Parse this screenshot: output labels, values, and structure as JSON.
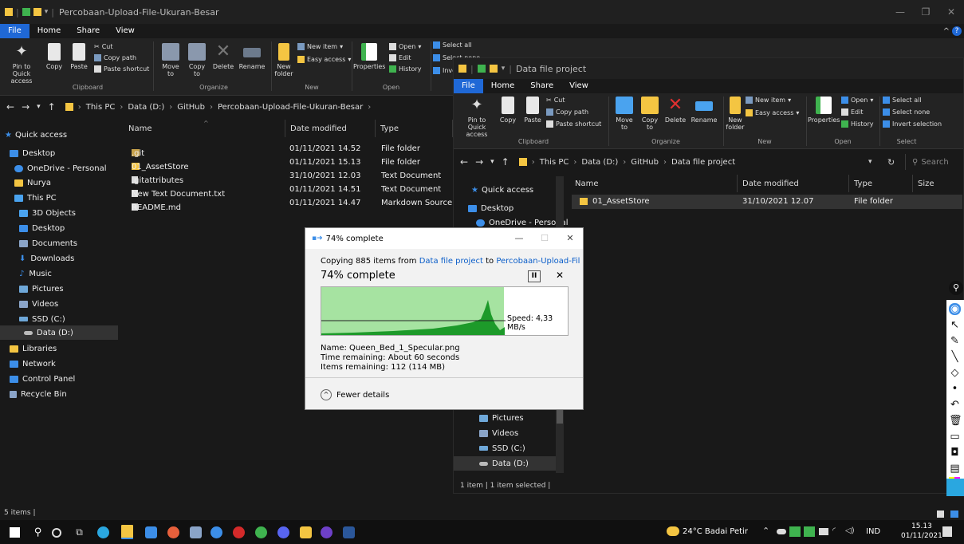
{
  "win1": {
    "title": "Percobaan-Upload-File-Ukuran-Besar",
    "tabs": [
      "File",
      "Home",
      "Share",
      "View"
    ],
    "ribbon": {
      "pin": "Pin to Quick access",
      "copy": "Copy",
      "paste": "Paste",
      "cut": "Cut",
      "copy_path": "Copy path",
      "paste_shortcut": "Paste shortcut",
      "move_to": "Move to",
      "copy_to": "Copy to",
      "delete": "Delete",
      "rename": "Rename",
      "new_folder": "New folder",
      "new_item": "New item",
      "easy_access": "Easy access",
      "properties": "Properties",
      "open": "Open",
      "edit": "Edit",
      "history": "History",
      "select_all": "Select all",
      "select_none": "Select none",
      "invert": "Invert selection",
      "groups": [
        "Clipboard",
        "Organize",
        "New",
        "Open"
      ]
    },
    "breadcrumb": [
      "This PC",
      "Data (D:)",
      "GitHub",
      "Percobaan-Upload-File-Ukuran-Besar"
    ],
    "nav": [
      {
        "label": "Quick access",
        "color": "#3c8ee8"
      },
      {
        "label": "Desktop",
        "color": "#3c8ee8"
      },
      {
        "label": "OneDrive - Personal",
        "color": "#3c8ee8"
      },
      {
        "label": "Nurya",
        "color": "#f4c542"
      },
      {
        "label": "This PC",
        "color": "#4aa3ef"
      },
      {
        "label": "3D Objects",
        "color": "#4aa3ef"
      },
      {
        "label": "Desktop",
        "color": "#3c8ee8"
      },
      {
        "label": "Documents",
        "color": "#8aa4c8"
      },
      {
        "label": "Downloads",
        "color": "#3c8ee8"
      },
      {
        "label": "Music",
        "color": "#3c8ee8"
      },
      {
        "label": "Pictures",
        "color": "#6ea7d8"
      },
      {
        "label": "Videos",
        "color": "#8aa4c8"
      },
      {
        "label": "SSD (C:)",
        "color": "#6ea7d8"
      },
      {
        "label": "Data (D:)",
        "color": "#bbbbbb"
      },
      {
        "label": "Libraries",
        "color": "#f4c542"
      },
      {
        "label": "Network",
        "color": "#3c8ee8"
      },
      {
        "label": "Control Panel",
        "color": "#3c8ee8"
      },
      {
        "label": "Recycle Bin",
        "color": "#8aa4c8"
      }
    ],
    "columns": {
      "name": "Name",
      "date": "Date modified",
      "type": "Type"
    },
    "files": [
      {
        "name": ".git",
        "date": "01/11/2021 14.52",
        "type": "File folder",
        "color": "#c8a24a"
      },
      {
        "name": "01_AssetStore",
        "date": "01/11/2021 15.13",
        "type": "File folder",
        "color": "#f4c542"
      },
      {
        "name": ".gitattributes",
        "date": "31/10/2021 12.03",
        "type": "Text Document",
        "color": "#dddddd"
      },
      {
        "name": "New Text Document.txt",
        "date": "01/11/2021 14.51",
        "type": "Text Document",
        "color": "#dddddd"
      },
      {
        "name": "README.md",
        "date": "01/11/2021 14.47",
        "type": "Markdown Source ...",
        "color": "#dddddd"
      }
    ],
    "status": "5 items |"
  },
  "win2": {
    "title": "Data file project",
    "tabs": [
      "File",
      "Home",
      "Share",
      "View"
    ],
    "groups": [
      "Clipboard",
      "Organize",
      "New",
      "Open",
      "Select"
    ],
    "breadcrumb": [
      "This PC",
      "Data (D:)",
      "GitHub",
      "Data file project"
    ],
    "search_placeholder": "Search",
    "nav_top": [
      {
        "label": "Quick access",
        "color": "#3c8ee8"
      },
      {
        "label": "Desktop",
        "color": "#3c8ee8"
      },
      {
        "label": "OneDrive - Personal",
        "color": "#3c8ee8"
      }
    ],
    "nav_bottom": [
      {
        "label": "Pictures",
        "color": "#6ea7d8"
      },
      {
        "label": "Videos",
        "color": "#8aa4c8"
      },
      {
        "label": "SSD (C:)",
        "color": "#6ea7d8"
      },
      {
        "label": "Data (D:)",
        "color": "#bbbbbb"
      }
    ],
    "columns": {
      "name": "Name",
      "date": "Date modified",
      "type": "Type",
      "size": "Size"
    },
    "files": [
      {
        "name": "01_AssetStore",
        "date": "31/10/2021 12.07",
        "type": "File folder"
      }
    ],
    "status": "1 item  |  1 item selected  |"
  },
  "dialog": {
    "title": "74% complete",
    "copying_prefix": "Copying 885 items from",
    "source": "Data file project",
    "to": "to",
    "dest": "Percobaan-Upload-File-Ukur...",
    "heading": "74% complete",
    "progress": 0.74,
    "speed": "Speed: 4,33 MB/s",
    "name": "Name: Queen_Bed_1_Specular.png",
    "time": "Time remaining: About 60 seconds",
    "items": "Items remaining: 112 (114 MB)",
    "fewer": "Fewer details"
  },
  "taskbar": {
    "weather": "24°C Badai Petir",
    "lang": "IND",
    "time": "15.13",
    "date": "01/11/2021"
  }
}
